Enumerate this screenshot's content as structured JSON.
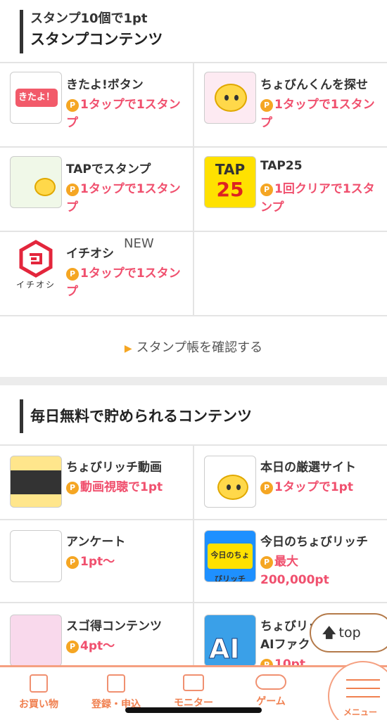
{
  "stamp_section": {
    "subtitle": "スタンプ10個で1pt",
    "title": "スタンプコンテンツ",
    "items": [
      {
        "title": "きたよ!ボタン",
        "reward": "1タップで1スタンプ",
        "thumb_text": "きたよ！"
      },
      {
        "title": "ちょびんくんを探せ",
        "reward": "1タップで1スタンプ"
      },
      {
        "title": "TAPでスタンプ",
        "reward": "1タップで1スタンプ"
      },
      {
        "title": "TAP25",
        "reward": "1回クリアで1スタンプ",
        "thumb_line1": "TAP",
        "thumb_line2": "25"
      },
      {
        "title": "イチオシ",
        "reward": "1タップで1スタンプ",
        "badge": "NEW",
        "thumb_text": "イチオシ"
      }
    ],
    "confirm_link": "スタンプ帳を確認する"
  },
  "daily_section": {
    "title": "毎日無料で貯められるコンテンツ",
    "items": [
      {
        "title": "ちょびリッチ動画",
        "reward": "動画視聴で1pt"
      },
      {
        "title": "本日の厳選サイト",
        "reward": "1タップで1pt"
      },
      {
        "title": "アンケート",
        "reward": "1pt〜"
      },
      {
        "title": "今日のちょびリッチ",
        "reward": "最大200,000pt",
        "thumb_text": "今日のちょびリッチ"
      },
      {
        "title": "スゴ得コンテンツ",
        "reward": "4pt〜"
      },
      {
        "title": "ちょびリッ",
        "title_line2": "AIファク",
        "reward": "10pt",
        "thumb_text": "AI"
      }
    ]
  },
  "coin_symbol": "P",
  "top_button": {
    "label": "top",
    "arrow": "🡅"
  },
  "bottom_nav": [
    {
      "label": "お買い物",
      "icon": "cart-icon"
    },
    {
      "label": "登録・申込",
      "icon": "form-icon"
    },
    {
      "label": "モニター",
      "icon": "monitor-icon"
    },
    {
      "label": "ゲーム",
      "icon": "gamepad-icon"
    }
  ],
  "menu_button": {
    "label": "メニュー",
    "icon": "hamburger-icon"
  },
  "colors": {
    "accent": "#f0506e",
    "coin": "#f5a623",
    "nav": "#f08050"
  }
}
